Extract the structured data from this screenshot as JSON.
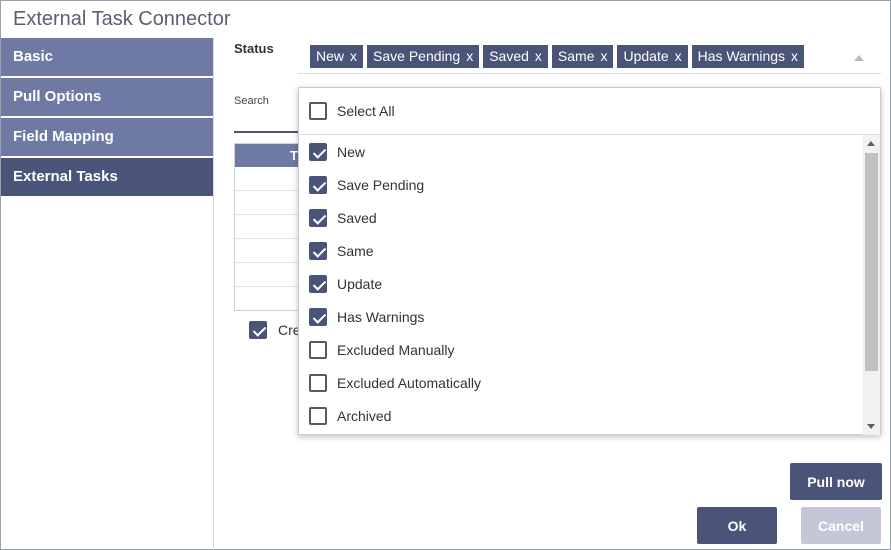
{
  "window": {
    "title": "External Task Connector"
  },
  "sidebar": {
    "items": [
      {
        "label": "Basic",
        "active": false
      },
      {
        "label": "Pull Options",
        "active": false
      },
      {
        "label": "Field Mapping",
        "active": false
      },
      {
        "label": "External Tasks",
        "active": true
      }
    ]
  },
  "status": {
    "label": "Status",
    "chip_remove": "x",
    "chips": [
      "New",
      "Save Pending",
      "Saved",
      "Same",
      "Update",
      "Has Warnings"
    ]
  },
  "search": {
    "label": "Search"
  },
  "grid": {
    "header": "T"
  },
  "create_option": {
    "label": "Cre",
    "checked": true
  },
  "dropdown": {
    "select_all": {
      "label": "Select All",
      "checked": false
    },
    "options": [
      {
        "label": "New",
        "checked": true
      },
      {
        "label": "Save Pending",
        "checked": true
      },
      {
        "label": "Saved",
        "checked": true
      },
      {
        "label": "Same",
        "checked": true
      },
      {
        "label": "Update",
        "checked": true
      },
      {
        "label": "Has Warnings",
        "checked": true
      },
      {
        "label": "Excluded Manually",
        "checked": false
      },
      {
        "label": "Excluded Automatically",
        "checked": false
      },
      {
        "label": "Archived",
        "checked": false
      }
    ]
  },
  "buttons": {
    "pull_now": "Pull now",
    "ok": "Ok",
    "cancel": "Cancel"
  },
  "colors": {
    "accent": "#4a5478",
    "sidebar": "#6e7aa4",
    "disabled": "#c4c8d6"
  }
}
